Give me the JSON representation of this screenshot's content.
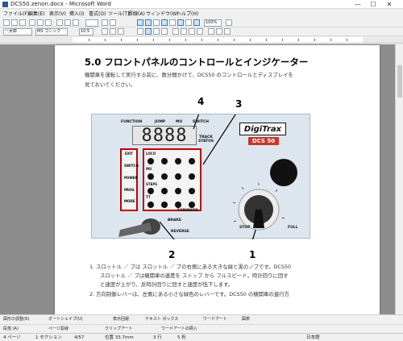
{
  "window": {
    "title": "DCS50.zenon.docx - Microsoft Word",
    "minimize_glyph": "—",
    "maximize_glyph": "☐",
    "close_glyph": "✕"
  },
  "menubar": {
    "items": [
      "ファイル(F)",
      "編集(E)",
      "表示(V)",
      "挿入(I)",
      "書式(O)",
      "ツール(T)",
      "罫線(A)",
      "ウィンドウ(W)",
      "ヘルプ(H)"
    ]
  },
  "toolbar": {
    "style_select": "一太郎",
    "font_select": "MS ゴシック",
    "size_select": "10.5",
    "zoom_select": "100%"
  },
  "document": {
    "heading": "5.0 フロントパネルのコントロールとインジケーター",
    "intro_line1": "機関車を運転して実行する前に、数分間かけて、DCS50 のコントロールとディスプレイを",
    "intro_line2": "見ておいてください。",
    "list_item1_line1": "1. スロットル ／ ブは スロットル ／ ブの右側にある大きな緑と黒のノブです。DCS50",
    "list_item1_line2": "スロットル ／ ブは機関車の速度を ストップ から フルスピード。時計回りに回す",
    "list_item1_line3": "と速度が上がり、反時計回りに回すと速度が低下します。",
    "list_item2_line1": "2. 方向制御レバーは、左側にある小さな緑色のレバーです。DCS50 の機関車の進行方"
  },
  "panel": {
    "brand": "DigiTrax",
    "model": "DCS 50",
    "top_labels": [
      "FUNCTION",
      "JUMP",
      "MU",
      "SWITCH"
    ],
    "display_digits": "8888",
    "track_status_line1": "TRACK",
    "track_status_line2": "STATUS",
    "left_keys": [
      "EXIT",
      "SWITCH",
      "POWER",
      "PROG",
      "MODE"
    ],
    "keypad_row_labels": [
      "LOCO",
      "MU",
      "STEPS",
      "TT"
    ],
    "forward_label": "FORWARD",
    "brake_label": "BRAKE",
    "reverse_label": "REVERSE",
    "stop_label": "STOP",
    "full_label": "FULL",
    "callouts": [
      "1",
      "2",
      "3",
      "4"
    ],
    "colors": {
      "panel_bg": "#dde6ee",
      "key_outline": "#c00000",
      "display_red": "#e01010",
      "knob": "#111111",
      "lever": "#555555"
    }
  },
  "drawbar": {
    "items": [
      "図形の調整(R)",
      "オートシェイプ(U)",
      "表示回避",
      "テキスト ボックス",
      "ワードアート",
      "図表"
    ],
    "items2": [
      "段落 (A)",
      "ページ罫線",
      "クリップアート",
      "ワードアートの挿入"
    ]
  },
  "statusbar": {
    "page": "4 ページ",
    "section": "1 セクション",
    "pagecount": "4/57",
    "position": "位置 33.7mm",
    "line": "3 行",
    "column": "5 桁",
    "language": "日本語"
  }
}
